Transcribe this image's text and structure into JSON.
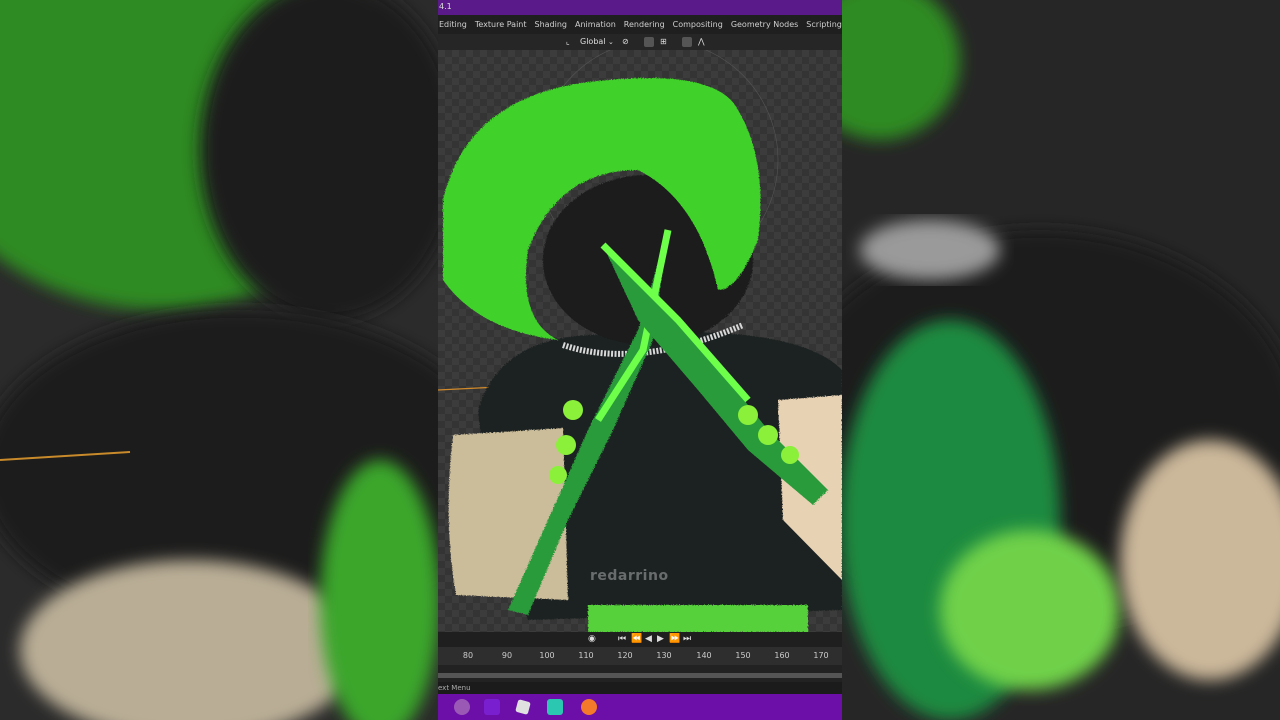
{
  "window": {
    "version": "4.1"
  },
  "workspace_tabs": [
    "Editing",
    "Texture Paint",
    "Shading",
    "Animation",
    "Rendering",
    "Compositing",
    "Geometry Nodes",
    "Scripting"
  ],
  "viewport_header": {
    "orientation": "Global"
  },
  "watermark": "redarrino",
  "timeline": {
    "ticks": [
      "80",
      "90",
      "100",
      "110",
      "120",
      "130",
      "140",
      "150",
      "160",
      "170"
    ]
  },
  "statusbar": {
    "text": "ext Menu"
  },
  "icons": {
    "transform_pivot": "pivot-icon",
    "snap": "snap-icon",
    "proportional": "proportional-editing-icon",
    "play": "play-icon",
    "jump_start": "jump-start-icon",
    "jump_end": "jump-end-icon"
  },
  "colors": {
    "titlebar": "#5a1a8a",
    "taskbar": "#6b0fa8",
    "hat_green": "#3fd12a",
    "sword_green": "#4df03a"
  }
}
